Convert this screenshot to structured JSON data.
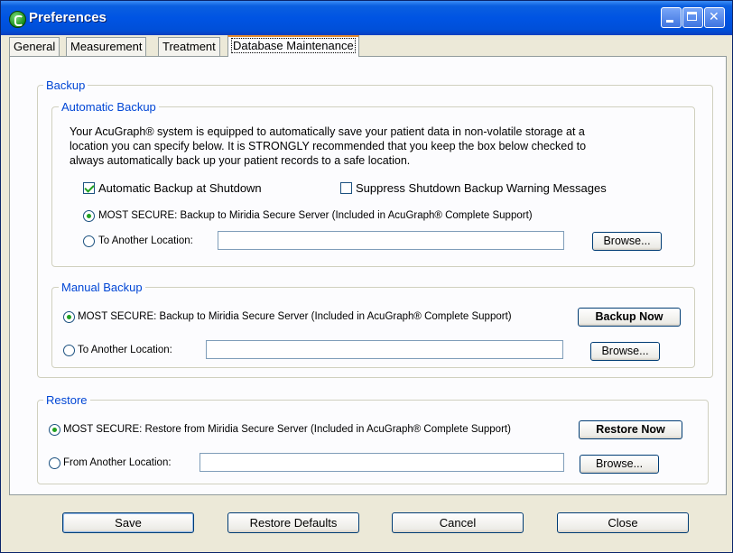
{
  "window": {
    "title": "Preferences"
  },
  "tabs": [
    {
      "label": "General"
    },
    {
      "label": "Measurement"
    },
    {
      "label": "Treatment"
    },
    {
      "label": "Database Maintenance"
    }
  ],
  "backup": {
    "legend": "Backup",
    "automatic": {
      "legend": "Automatic Backup",
      "description_lines": [
        "Your AcuGraph® system is equipped to automatically save your  patient data in non-volatile storage at a",
        "location you can specify below. It is STRONGLY recommended that you keep the box below checked to",
        "always automatically back up your patient records to a safe location."
      ],
      "auto_backup_label": "Automatic Backup at Shutdown",
      "suppress_label": "Suppress Shutdown Backup Warning Messages",
      "secure_label": "MOST SECURE: Backup to Miridia Secure Server (Included in AcuGraph® Complete Support)",
      "other_label": "To Another Location:",
      "location_value": "",
      "browse_label": "Browse..."
    },
    "manual": {
      "legend": "Manual Backup",
      "secure_label": "MOST SECURE: Backup to Miridia Secure Server (Included in AcuGraph® Complete Support)",
      "backup_now_label": "Backup Now",
      "other_label": "To Another Location:",
      "location_value": "",
      "browse_label": "Browse..."
    }
  },
  "restore": {
    "legend": "Restore",
    "secure_label": "MOST SECURE: Restore from Miridia Secure Server (Included in AcuGraph® Complete Support)",
    "restore_now_label": "Restore Now",
    "other_label": "From Another Location:",
    "location_value": "",
    "browse_label": "Browse..."
  },
  "footer": {
    "save_label": "Save",
    "restore_defaults_label": "Restore Defaults",
    "cancel_label": "Cancel",
    "close_label": "Close"
  },
  "colors": {
    "accent": "#0046d5",
    "titlebar": "#0054e3",
    "tab_highlight": "#e68b2c"
  },
  "state": {
    "auto_backup_checked": true,
    "suppress_checked": false,
    "auto_destination": "secure",
    "manual_destination": "secure",
    "restore_source": "secure"
  }
}
